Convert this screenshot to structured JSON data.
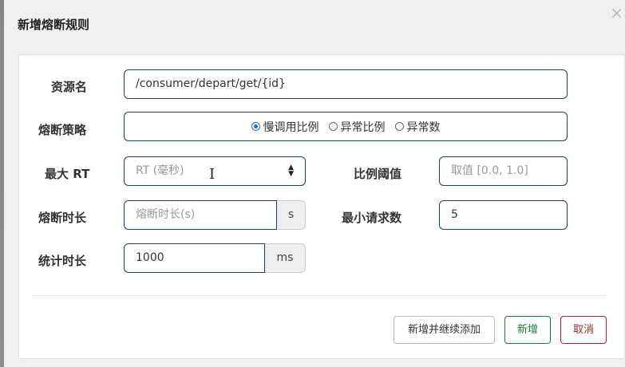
{
  "dialog": {
    "title": "新增熔断规则",
    "close_glyph": "×"
  },
  "form": {
    "resource": {
      "label": "资源名",
      "value": "/consumer/depart/get/{id}"
    },
    "strategy": {
      "label": "熔断策略",
      "options": [
        {
          "label": "慢调用比例",
          "checked": true
        },
        {
          "label": "异常比例",
          "checked": false
        },
        {
          "label": "异常数",
          "checked": false
        }
      ]
    },
    "max_rt": {
      "label": "最大 RT",
      "placeholder": "RT (毫秒)"
    },
    "ratio_threshold": {
      "label": "比例阈值",
      "placeholder": "取值 [0.0, 1.0]"
    },
    "break_duration": {
      "label": "熔断时长",
      "placeholder": "熔断时长(s)",
      "unit": "s"
    },
    "min_requests": {
      "label": "最小请求数",
      "value": "5"
    },
    "stat_duration": {
      "label": "统计时长",
      "value": "1000",
      "unit": "ms"
    }
  },
  "footer": {
    "add_continue_label": "新增并继续添加",
    "add_label": "新增",
    "cancel_label": "取消"
  },
  "colors": {
    "input_border": "#1a3e6e",
    "radio_checked": "#1c6dd0",
    "success": "#1f7a3a",
    "danger": "#9c2a2a"
  }
}
